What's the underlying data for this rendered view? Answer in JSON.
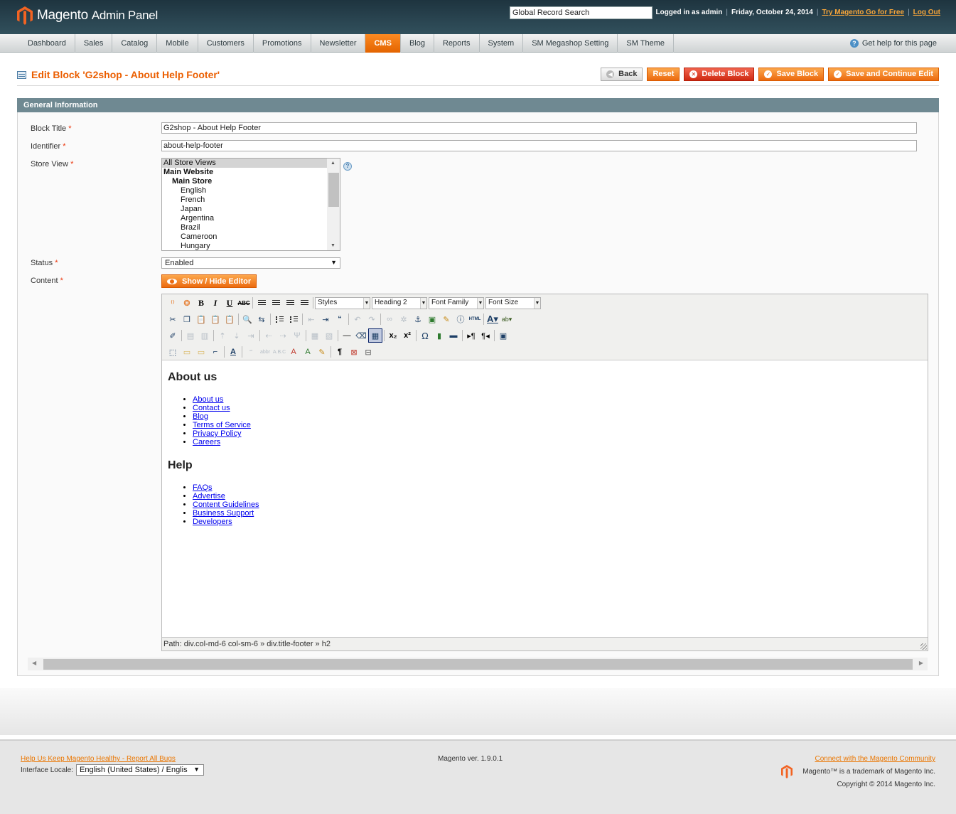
{
  "header": {
    "brand": "Magento",
    "brand_sub": "Admin Panel",
    "search_value": "Global Record Search",
    "logged_in": "Logged in as admin",
    "date": "Friday, October 24, 2014",
    "try_link": "Try Magento Go for Free",
    "logout": "Log Out"
  },
  "nav": {
    "items": [
      "Dashboard",
      "Sales",
      "Catalog",
      "Mobile",
      "Customers",
      "Promotions",
      "Newsletter",
      "CMS",
      "Blog",
      "Reports",
      "System",
      "SM Megashop Setting",
      "SM Theme"
    ],
    "active": "CMS",
    "help": "Get help for this page"
  },
  "page": {
    "title": "Edit Block 'G2shop - About Help Footer'",
    "buttons": {
      "back": "Back",
      "reset": "Reset",
      "delete": "Delete Block",
      "save": "Save Block",
      "save_continue": "Save and Continue Edit"
    }
  },
  "form": {
    "section": "General Information",
    "block_title_label": "Block Title",
    "block_title_value": "G2shop - About Help Footer",
    "identifier_label": "Identifier",
    "identifier_value": "about-help-footer",
    "store_view_label": "Store View",
    "store_views": [
      {
        "label": "All Store Views",
        "level": 0,
        "selected": true,
        "bold": false
      },
      {
        "label": "Main Website",
        "level": 0,
        "selected": false,
        "bold": true
      },
      {
        "label": "Main Store",
        "level": 1,
        "selected": false,
        "bold": true
      },
      {
        "label": "English",
        "level": 2,
        "selected": false,
        "bold": false
      },
      {
        "label": "French",
        "level": 2,
        "selected": false,
        "bold": false
      },
      {
        "label": "Japan",
        "level": 2,
        "selected": false,
        "bold": false
      },
      {
        "label": "Argentina",
        "level": 2,
        "selected": false,
        "bold": false
      },
      {
        "label": "Brazil",
        "level": 2,
        "selected": false,
        "bold": false
      },
      {
        "label": "Cameroon",
        "level": 2,
        "selected": false,
        "bold": false
      },
      {
        "label": "Hungary",
        "level": 2,
        "selected": false,
        "bold": false
      }
    ],
    "status_label": "Status",
    "status_value": "Enabled",
    "content_label": "Content",
    "toggle_editor": "Show / Hide Editor",
    "required_mark": "*"
  },
  "editor": {
    "dropdowns": {
      "styles": "Styles",
      "format": "Heading 2",
      "font_family": "Font Family",
      "font_size": "Font Size"
    },
    "sections": [
      {
        "heading": "About us",
        "links": [
          "About us",
          "Contact us",
          "Blog",
          "Terms of Service",
          "Privacy Policy",
          "Careers"
        ]
      },
      {
        "heading": "Help",
        "links": [
          "FAQs",
          "Advertise",
          "Content Guidelines",
          "Business Support",
          "Developers"
        ]
      }
    ],
    "path": "Path: div.col-md-6 col-sm-6 » div.title-footer » h2"
  },
  "footer": {
    "report_bugs": "Help Us Keep Magento Healthy - Report All Bugs",
    "locale_label": "Interface Locale:",
    "locale_value": "English (United States) / Englis",
    "version": "Magento ver. 1.9.0.1",
    "community": "Connect with the Magento Community",
    "trademark": "Magento™ is a trademark of Magento Inc.",
    "copyright": "Copyright © 2014 Magento Inc."
  },
  "colors": {
    "accent": "#eb5e00",
    "header_bg": "#2a4551",
    "section_bg": "#6f8992"
  }
}
